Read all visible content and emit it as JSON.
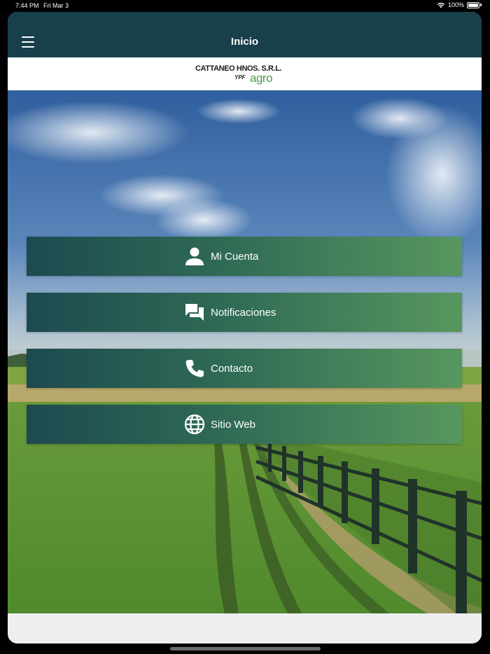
{
  "status_bar": {
    "time": "7:44 PM",
    "date": "Fri Mar 3",
    "battery": "100%",
    "icons": [
      "wifi-icon",
      "battery-icon"
    ]
  },
  "nav": {
    "title": "Inicio",
    "menu_icon": "hamburger-menu-icon"
  },
  "logo": {
    "line1": "CATTANEO HNOS. S.R.L.",
    "brand_small": "YPF",
    "brand_large": "agro"
  },
  "menu": {
    "items": [
      {
        "label": "Mi Cuenta",
        "icon": "person-icon"
      },
      {
        "label": "Notificaciones",
        "icon": "chat-bubbles-icon"
      },
      {
        "label": "Contacto",
        "icon": "phone-icon"
      },
      {
        "label": "Sitio Web",
        "icon": "globe-icon"
      }
    ]
  },
  "colors": {
    "nav_background": "#173f4c",
    "button_gradient_start": "#1d4a4f",
    "button_gradient_end": "#57975f",
    "logo_agro": "#4f9a4c"
  }
}
